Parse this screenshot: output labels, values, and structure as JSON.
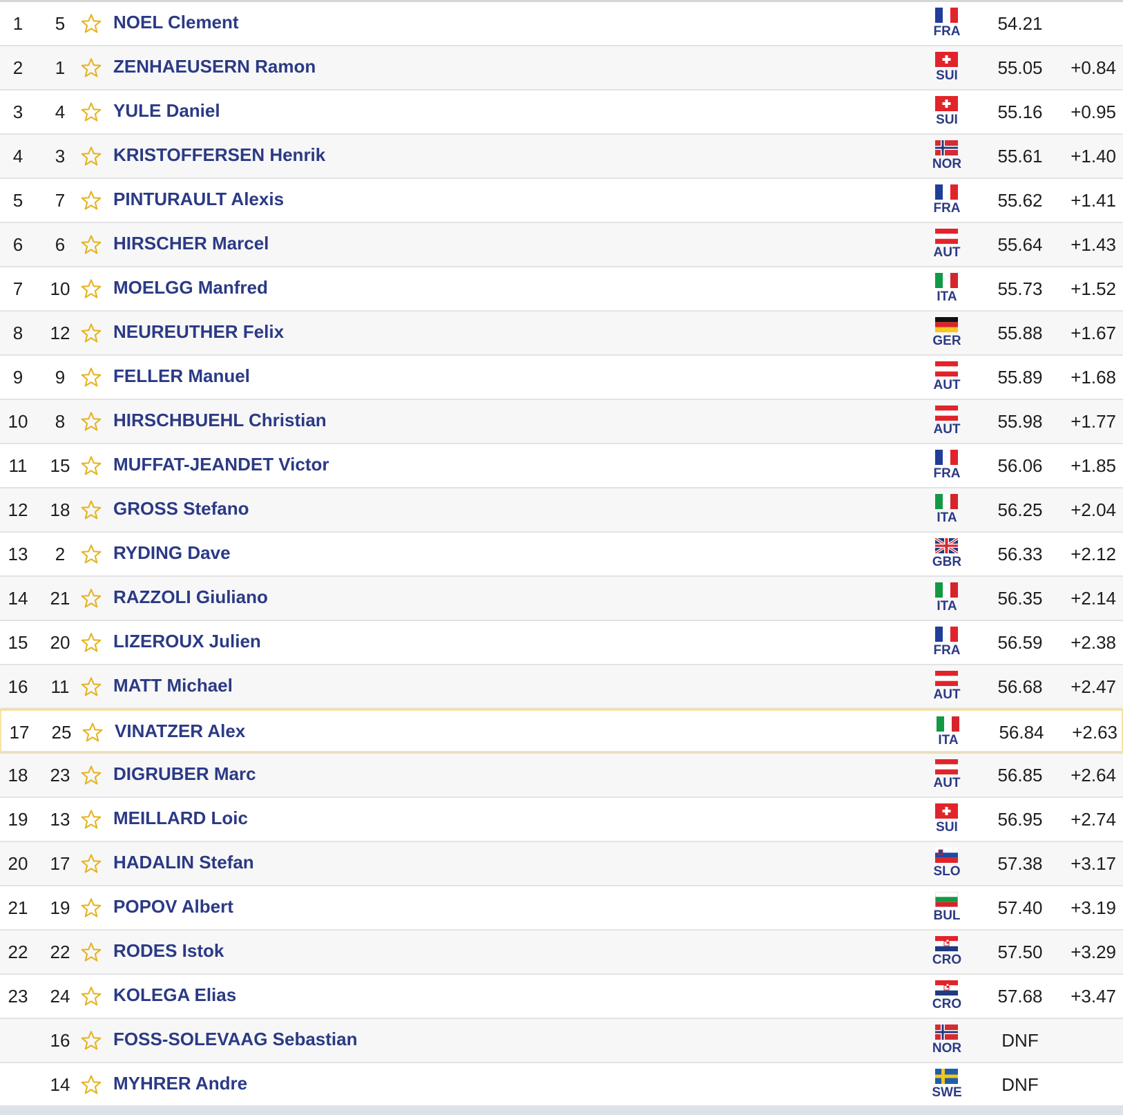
{
  "colors": {
    "name": "#2b3a85",
    "star": "#e6b422",
    "highlight": "#f7e2a6"
  },
  "icons": {
    "favorite": "star-outline-icon"
  },
  "rows": [
    {
      "rank": "1",
      "bib": "5",
      "name": "NOEL Clement",
      "nation": "FRA",
      "time": "54.21",
      "diff": ""
    },
    {
      "rank": "2",
      "bib": "1",
      "name": "ZENHAEUSERN Ramon",
      "nation": "SUI",
      "time": "55.05",
      "diff": "+0.84"
    },
    {
      "rank": "3",
      "bib": "4",
      "name": "YULE Daniel",
      "nation": "SUI",
      "time": "55.16",
      "diff": "+0.95"
    },
    {
      "rank": "4",
      "bib": "3",
      "name": "KRISTOFFERSEN Henrik",
      "nation": "NOR",
      "time": "55.61",
      "diff": "+1.40"
    },
    {
      "rank": "5",
      "bib": "7",
      "name": "PINTURAULT Alexis",
      "nation": "FRA",
      "time": "55.62",
      "diff": "+1.41"
    },
    {
      "rank": "6",
      "bib": "6",
      "name": "HIRSCHER Marcel",
      "nation": "AUT",
      "time": "55.64",
      "diff": "+1.43"
    },
    {
      "rank": "7",
      "bib": "10",
      "name": "MOELGG Manfred",
      "nation": "ITA",
      "time": "55.73",
      "diff": "+1.52"
    },
    {
      "rank": "8",
      "bib": "12",
      "name": "NEUREUTHER Felix",
      "nation": "GER",
      "time": "55.88",
      "diff": "+1.67"
    },
    {
      "rank": "9",
      "bib": "9",
      "name": "FELLER Manuel",
      "nation": "AUT",
      "time": "55.89",
      "diff": "+1.68"
    },
    {
      "rank": "10",
      "bib": "8",
      "name": "HIRSCHBUEHL Christian",
      "nation": "AUT",
      "time": "55.98",
      "diff": "+1.77"
    },
    {
      "rank": "11",
      "bib": "15",
      "name": "MUFFAT-JEANDET Victor",
      "nation": "FRA",
      "time": "56.06",
      "diff": "+1.85"
    },
    {
      "rank": "12",
      "bib": "18",
      "name": "GROSS Stefano",
      "nation": "ITA",
      "time": "56.25",
      "diff": "+2.04"
    },
    {
      "rank": "13",
      "bib": "2",
      "name": "RYDING Dave",
      "nation": "GBR",
      "time": "56.33",
      "diff": "+2.12"
    },
    {
      "rank": "14",
      "bib": "21",
      "name": "RAZZOLI Giuliano",
      "nation": "ITA",
      "time": "56.35",
      "diff": "+2.14"
    },
    {
      "rank": "15",
      "bib": "20",
      "name": "LIZEROUX Julien",
      "nation": "FRA",
      "time": "56.59",
      "diff": "+2.38"
    },
    {
      "rank": "16",
      "bib": "11",
      "name": "MATT Michael",
      "nation": "AUT",
      "time": "56.68",
      "diff": "+2.47"
    },
    {
      "rank": "17",
      "bib": "25",
      "name": "VINATZER Alex",
      "nation": "ITA",
      "time": "56.84",
      "diff": "+2.63",
      "highlight": true
    },
    {
      "rank": "18",
      "bib": "23",
      "name": "DIGRUBER Marc",
      "nation": "AUT",
      "time": "56.85",
      "diff": "+2.64"
    },
    {
      "rank": "19",
      "bib": "13",
      "name": "MEILLARD Loic",
      "nation": "SUI",
      "time": "56.95",
      "diff": "+2.74"
    },
    {
      "rank": "20",
      "bib": "17",
      "name": "HADALIN Stefan",
      "nation": "SLO",
      "time": "57.38",
      "diff": "+3.17"
    },
    {
      "rank": "21",
      "bib": "19",
      "name": "POPOV Albert",
      "nation": "BUL",
      "time": "57.40",
      "diff": "+3.19"
    },
    {
      "rank": "22",
      "bib": "22",
      "name": "RODES Istok",
      "nation": "CRO",
      "time": "57.50",
      "diff": "+3.29"
    },
    {
      "rank": "23",
      "bib": "24",
      "name": "KOLEGA Elias",
      "nation": "CRO",
      "time": "57.68",
      "diff": "+3.47"
    },
    {
      "rank": "",
      "bib": "16",
      "name": "FOSS-SOLEVAAG Sebastian",
      "nation": "NOR",
      "time": "DNF",
      "diff": ""
    },
    {
      "rank": "",
      "bib": "14",
      "name": "MYHRER Andre",
      "nation": "SWE",
      "time": "DNF",
      "diff": ""
    }
  ]
}
